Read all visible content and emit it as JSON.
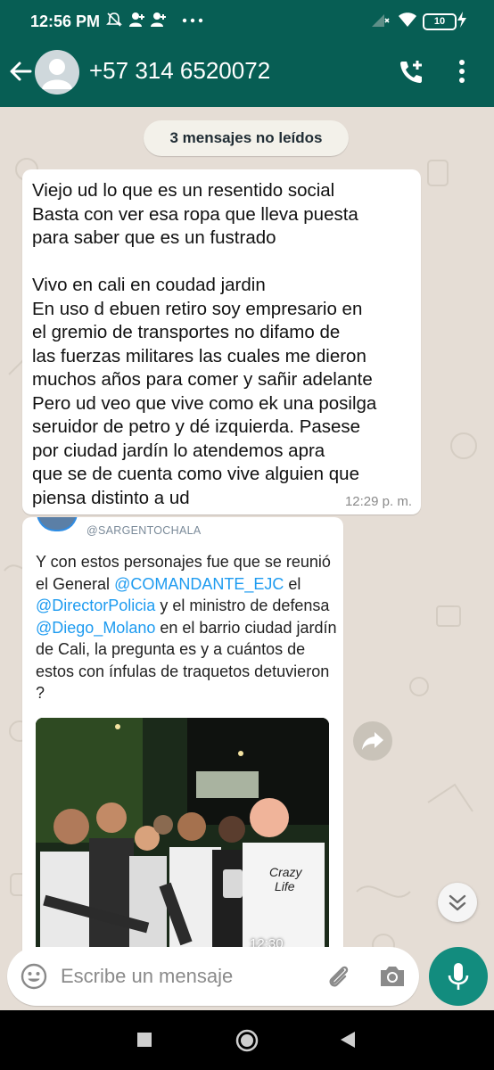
{
  "status_bar": {
    "time": "12:56 PM",
    "battery": "10"
  },
  "header": {
    "contact_name": "+57 314 6520072"
  },
  "chat": {
    "unread_banner": "3 mensajes no leídos",
    "message1": {
      "text": "Viejo ud lo que es un resentido social\nBasta con ver esa ropa que lleva puesta\npara saber que es un fustrado\n\nVivo en cali en coudad jardin\nEn uso d ebuen retiro soy empresario en\nel gremio de transportes no difamo de\nlas fuerzas militares las cuales me dieron\nmuchos años para comer y sañir adelante\nPero ud veo que vive como ek una posilga\nseruidor de petro y dé izquierda. Pasese\npor ciudad jardín lo atendemos apra\nque se de cuenta como vive alguien que\npiensa distinto a ud",
      "time": "12:29 p. m."
    },
    "message2": {
      "tweet_handle": "@SARGENTOCHALA",
      "tweet_text_1": "Y con estos personajes fue que se reunió el General ",
      "mention_1": "@COMANDANTE_EJC",
      "tweet_text_2": " el ",
      "mention_2": "@DirectorPolicia",
      "tweet_text_3": " y el ministro de defensa ",
      "mention_3": "@Diego_Molano",
      "tweet_text_4": " en el barrio ciudad jardín de Cali, la pregunta es y a cuántos de estos con ínfulas de traquetos detuvieron ?",
      "shirt_text": "Crazy\nLife",
      "time": "12:30"
    }
  },
  "composer": {
    "placeholder": "Escribe un mensaje"
  },
  "icons": {
    "back": "arrow-back-icon",
    "call": "add-call-icon",
    "menu": "more-vert-icon",
    "emoji": "emoji-icon",
    "attach": "paperclip-icon",
    "camera": "camera-icon",
    "mic": "microphone-icon",
    "forward": "forward-icon",
    "scroll": "chevron-double-down-icon"
  },
  "colors": {
    "header": "#075e54",
    "accent": "#128c7e",
    "mention": "#1d9bf0",
    "chat_bg": "#e5ddd5"
  }
}
